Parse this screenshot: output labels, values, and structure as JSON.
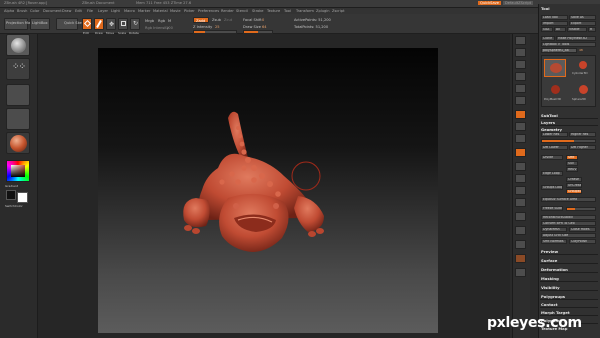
{
  "titlebar": {
    "app": "ZBrush 4R2 [Rover.app]",
    "document": "ZBrush Document",
    "stats": "Mem 711 Free 453 ZTime 27.6",
    "right_button": "QuickSave",
    "default_script": "DefaultZScript"
  },
  "menu": [
    "Alpha",
    "Brush",
    "Color",
    "Document",
    "Draw",
    "Edit",
    "File",
    "Layer",
    "Light",
    "Macro",
    "Marker",
    "Material",
    "Movie",
    "Picker",
    "Preferences",
    "Render",
    "Stencil",
    "Stroke",
    "Texture",
    "Tool",
    "Transform",
    "Zplugin",
    "Zscript"
  ],
  "shelf": {
    "projection_master": "Projection Master",
    "lightbox": "LightBox",
    "quick_sketch": "Quick Sketch",
    "edit": "Edit",
    "draw": "Draw",
    "move": "Move",
    "scale": "Scale",
    "rotate": "Rotate",
    "mrgb": "Mrgb",
    "rgb": "Rgb",
    "m": "M",
    "zadd": "Zadd",
    "zsub": "Zsub",
    "zcut": "Zcut",
    "focal_shift_label": "Focal Shift",
    "focal_shift_value": "0",
    "draw_size_label": "Draw Size",
    "draw_size_value": "64",
    "z_intensity_label": "Z Intensity",
    "z_intensity_value": "25",
    "rgb_intensity_label": "Rgb Intensity",
    "rgb_intensity_value": "100",
    "active_points": "ActivePoints: 51,200",
    "total_points": "TotalPoints: 51,200",
    "z_intensity_fill": 0.25,
    "draw_size_fill": 0.5
  },
  "left_tray": {
    "gradient_label": "Gradient",
    "switch_color_label": "SwitchColor"
  },
  "palette": {
    "title": "Tool",
    "load_tool": "Load Tool",
    "save_as": "Save As",
    "import": "Import",
    "export": "Export",
    "clone": "Clone",
    "make_polymesh": "Make PolyMesh3D",
    "goz": "GoZ",
    "all": "All",
    "visible": "Visible",
    "r": "R",
    "lightbox_tools": "Lightbox > Tools",
    "current_tool": "polySphere1_48",
    "subtools": [
      "Cylinder3D",
      "PolyMesh3D",
      "SimpleBrush",
      "Sphere3D"
    ],
    "sections": [
      "SubTool",
      "Layers",
      "Geometry",
      "Preview",
      "Surface",
      "Deformation",
      "Masking",
      "Visibility",
      "Polygroups",
      "Contact",
      "Morph Target",
      "Polypaint",
      "Texture Map"
    ],
    "geometry_items": [
      "Lower Res",
      "Higher Res",
      "Del Lower",
      "Del Higher",
      "Divide",
      "Smt",
      "Suv",
      "ReUV",
      "Edge Loop",
      "Crease",
      "UnCrease",
      "Groups Loops",
      "GroupsSplit",
      "EquaSiz Surface Area",
      "Freeze Subdivision Levels",
      "ReconstructSubdiv",
      "Convert BPR To Geo",
      "DynaMesh",
      "Close Holes",
      "Adjust Grid Size",
      "Smt Normals",
      "ClayPolish",
      "Check Mesh",
      "Project"
    ]
  },
  "colors": {
    "accent": "#e06a1c",
    "model": "#c8553e"
  },
  "watermark": "pxleyes.com"
}
